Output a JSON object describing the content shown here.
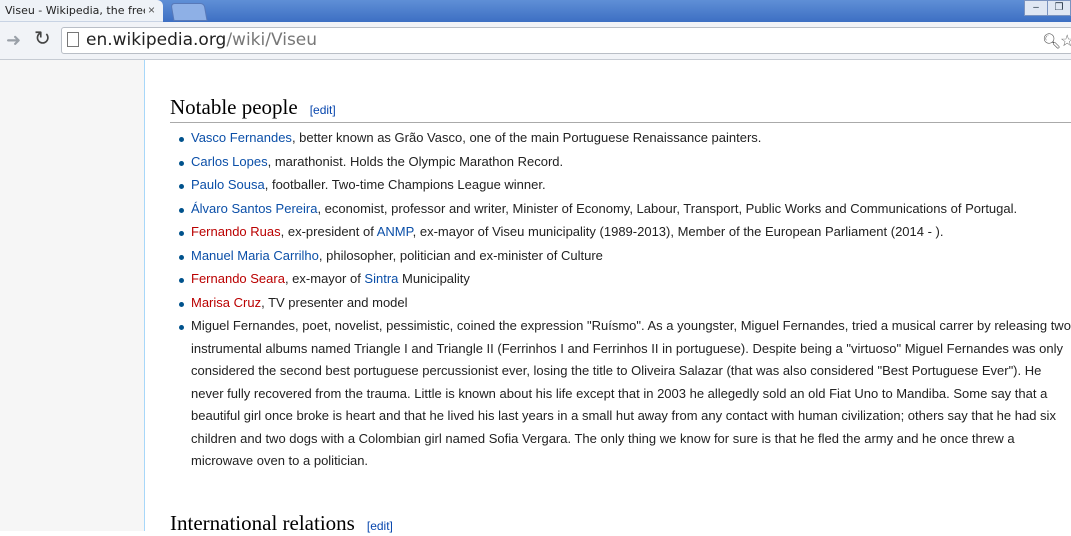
{
  "browser": {
    "tab_title": "Viseu - Wikipedia, the free encyclopedia",
    "url_host": "en.wikipedia.org",
    "url_path": "/wiki/Viseu"
  },
  "article": {
    "section1_title": "Notable people",
    "edit_label": "[edit]",
    "section2_title": "International relations",
    "people": [
      {
        "link": "Vasco Fernandes",
        "link_state": "blue",
        "text": ", better known as Grão Vasco, one of the main Portuguese Renaissance painters."
      },
      {
        "link": "Carlos Lopes",
        "link_state": "blue",
        "text": ", marathonist. Holds the Olympic Marathon Record."
      },
      {
        "link": "Paulo Sousa",
        "link_state": "blue",
        "text": ", footballer. Two-time Champions League winner."
      },
      {
        "link": "Álvaro Santos Pereira",
        "link_state": "blue",
        "text": ", economist, professor and writer, Minister of Economy, Labour, Transport, Public Works and Communications of Portugal."
      },
      {
        "link": "Fernando Ruas",
        "link_state": "red",
        "text_a": ", ex-president of ",
        "link2": "ANMP",
        "text_b": ", ex-mayor of Viseu municipality (1989-2013), Member of the European Parliament (2014 - )."
      },
      {
        "link": "Manuel Maria Carrilho",
        "link_state": "blue",
        "text": ", philosopher, politician and ex-minister of Culture"
      },
      {
        "link": "Fernando Seara",
        "link_state": "red",
        "text_a": ", ex-mayor of ",
        "link2": "Sintra",
        "text_b": " Municipality"
      },
      {
        "link": "Marisa Cruz",
        "link_state": "red",
        "text": ", TV presenter and model"
      },
      {
        "text": "Miguel Fernandes, poet, novelist, pessimistic, coined the expression \"Ruísmo\". As a youngster, Miguel Fernandes, tried a musical carrer by releasing two instrumental albums named Triangle I and Triangle II (Ferrinhos I and Ferrinhos II in portuguese). Despite being a \"virtuoso\" Miguel Fernandes was only considered the second best portuguese percussionist ever, losing the title to Oliveira Salazar (that was also considered \"Best Portuguese Ever\"). He never fully recovered from the trauma. Little is known about his life except that in 2003 he allegedly sold an old Fiat Uno to Mandiba. Some say that a beautiful girl once broke is heart and that he lived his last years in a small hut away from any contact with human civilization; others say that he had six children and two dogs with a Colombian girl named Sofia Vergara. The only thing we know for sure is that he fled the army and he once threw a microwave oven to a politician."
      }
    ]
  },
  "colors": {
    "link_blue": "#0b4fa8",
    "link_red": "#ba0000",
    "tab_strip": "#4a7bcc"
  }
}
